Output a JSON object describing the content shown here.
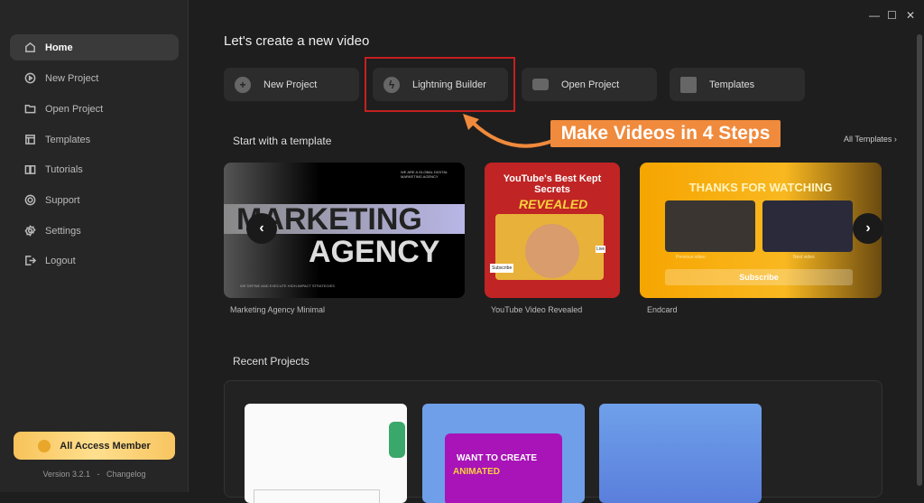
{
  "window": {
    "minimize": "—",
    "maximize": "☐",
    "close": "✕"
  },
  "sidebar": {
    "items": [
      {
        "label": "Home",
        "icon": "home-icon"
      },
      {
        "label": "New Project",
        "icon": "play-circle-icon"
      },
      {
        "label": "Open Project",
        "icon": "folder-icon"
      },
      {
        "label": "Templates",
        "icon": "layout-icon"
      },
      {
        "label": "Tutorials",
        "icon": "book-icon"
      },
      {
        "label": "Support",
        "icon": "lifebuoy-icon"
      },
      {
        "label": "Settings",
        "icon": "gear-icon"
      },
      {
        "label": "Logout",
        "icon": "logout-icon"
      }
    ],
    "member": "All Access Member",
    "version": "Version 3.2.1",
    "sep": "-",
    "changelog": "Changelog"
  },
  "main": {
    "title": "Let's create a new video",
    "quick": [
      {
        "label": "New Project",
        "icon": "+"
      },
      {
        "label": "Lightning Builder",
        "icon": "ϟ"
      },
      {
        "label": "Open Project",
        "icon": ""
      },
      {
        "label": "Templates",
        "icon": ""
      }
    ],
    "callout": "Make Videos in 4 Steps",
    "templates_title": "Start with a template",
    "all_templates": "All Templates ›",
    "templates": [
      {
        "name": "Marketing Agency Minimal",
        "line1": "MARKETING",
        "line2": "AGENCY",
        "top": "WE ARE A GLOBAL DIGITAL MARKETING AGENCY",
        "bottom": "WE DEFINE AND EXECUTE HIGH-IMPACT STRATEGIES"
      },
      {
        "name": "YouTube Video Revealed",
        "line1": "YouTube's Best Kept Secrets",
        "line2": "REVEALED",
        "badge": "Subscribe",
        "live": "Live"
      },
      {
        "name": "Endcard",
        "line1": "THANKS FOR WATCHING",
        "prev": "Previous video",
        "next": "Next video",
        "button": "Subscribe"
      }
    ],
    "recent_title": "Recent Projects",
    "recent": [
      {
        "text": ""
      },
      {
        "text": "WANT TO CREATE",
        "text2": "ANIMATED"
      },
      {
        "text": ""
      }
    ]
  },
  "colors": {
    "accent": "#f08a3c",
    "highlight": "#c42020",
    "member": "#f7c35a"
  }
}
